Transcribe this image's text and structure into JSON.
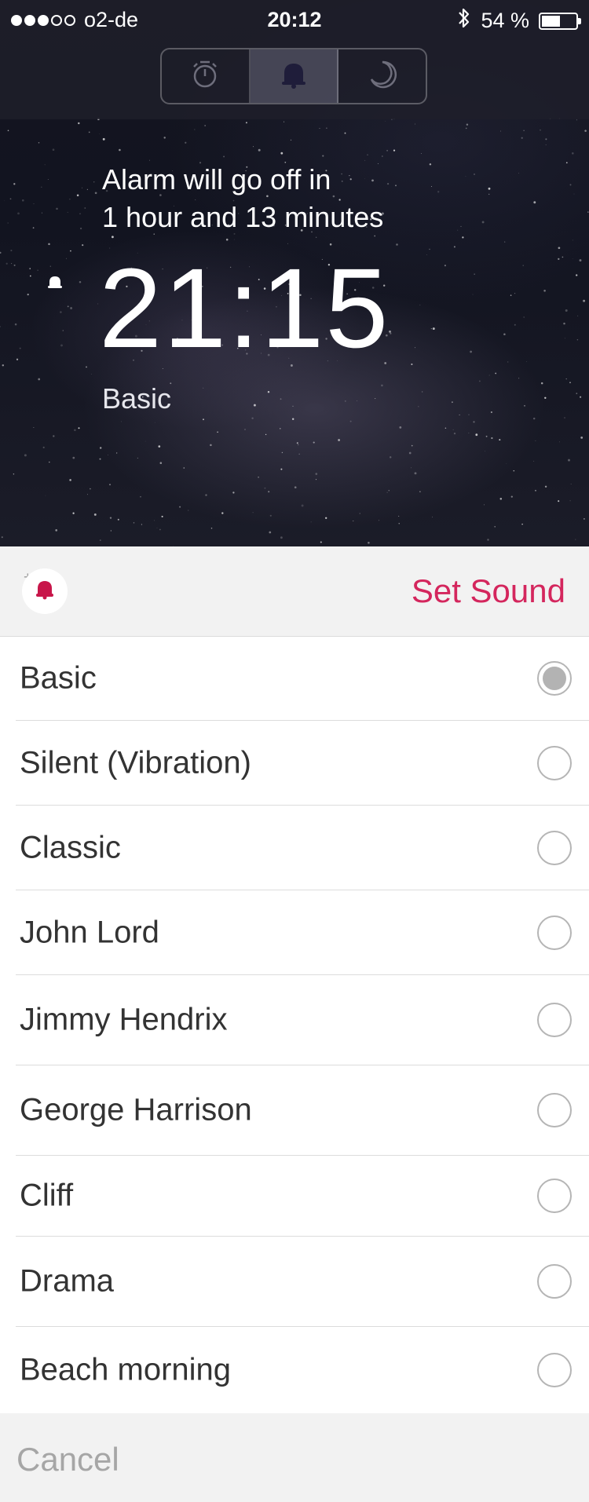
{
  "status_bar": {
    "carrier": "o2-de",
    "time": "20:12",
    "battery_text": "54 %",
    "battery_level": 0.54,
    "signal_bars_filled": 3,
    "signal_bars_total": 5
  },
  "mode_tabs": [
    {
      "icon": "stopwatch-icon",
      "active": false
    },
    {
      "icon": "bell-icon",
      "active": true
    },
    {
      "icon": "moon-icon",
      "active": false
    }
  ],
  "alarm": {
    "countdown_line1": "Alarm will go off in",
    "countdown_line2": "1 hour and 13 minutes",
    "time": "21:15",
    "sound_name": "Basic"
  },
  "sheet": {
    "title": "Set Sound",
    "cancel_label": "Cancel",
    "accent_color": "#d4265d"
  },
  "sounds": [
    {
      "label": "Basic",
      "selected": true
    },
    {
      "label": "Silent (Vibration)",
      "selected": false
    },
    {
      "label": "Classic",
      "selected": false
    },
    {
      "label": "John Lord",
      "selected": false
    },
    {
      "label": "Jimmy Hendrix",
      "selected": false
    },
    {
      "label": "George Harrison",
      "selected": false
    },
    {
      "label": "Cliff",
      "selected": false
    },
    {
      "label": "Drama",
      "selected": false
    },
    {
      "label": "Beach morning",
      "selected": false
    }
  ]
}
